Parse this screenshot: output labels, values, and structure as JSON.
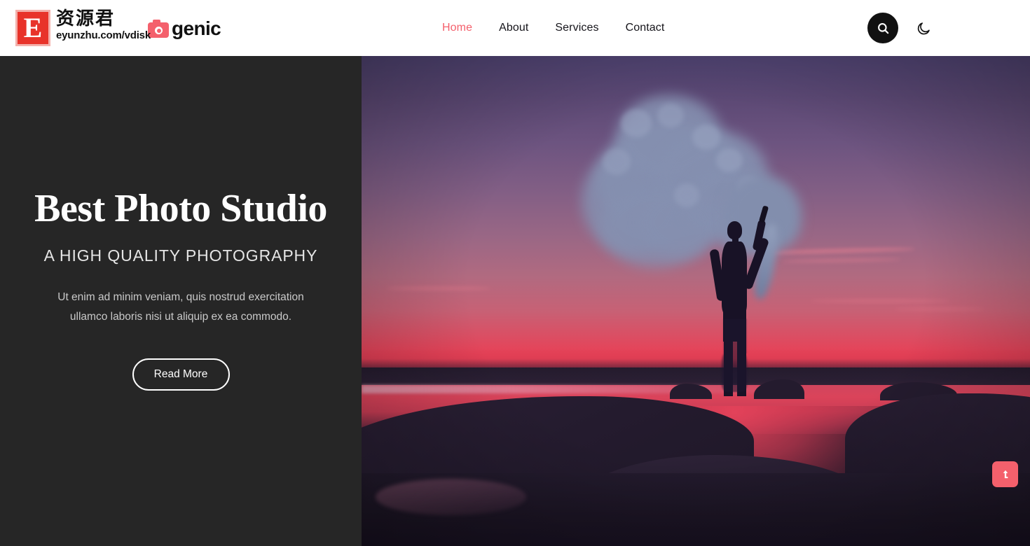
{
  "watermark": {
    "badge_letter": "E",
    "cn_name": "资源君",
    "url": "eyunzhu.com/vdisk"
  },
  "header": {
    "brand": {
      "icon": "camera-icon",
      "name": "genic"
    },
    "nav": [
      {
        "label": "Home",
        "active": true
      },
      {
        "label": "About",
        "active": false
      },
      {
        "label": "Services",
        "active": false
      },
      {
        "label": "Contact",
        "active": false
      }
    ],
    "tools": [
      {
        "icon": "search-icon",
        "label": "Search"
      },
      {
        "icon": "moon-icon",
        "label": "Dark mode"
      }
    ],
    "background": "#ffffff",
    "active_color": "#f4606c"
  },
  "hero": {
    "title": "Best Photo Studio",
    "subtitle": "A HIGH QUALITY PHOTOGRAPHY",
    "description": "Ut enim ad minim veniam, quis nostrud exercitation ullamco laboris nisi ut aliquip ex ea commodo.",
    "cta_label": "Read More",
    "panel_background": "#262626",
    "photo": {
      "alt": "Silhouette of a person holding a smoke flare at sunset on a beach",
      "sky_top": "#4e4270",
      "sky_horizon": "#e84056",
      "smoke_color": "#8590b0",
      "silhouette": "#181226"
    }
  },
  "floating": {
    "back_to_top": {
      "icon": "arrow-up-icon",
      "label": "Back to top",
      "color": "#f4606c"
    }
  }
}
